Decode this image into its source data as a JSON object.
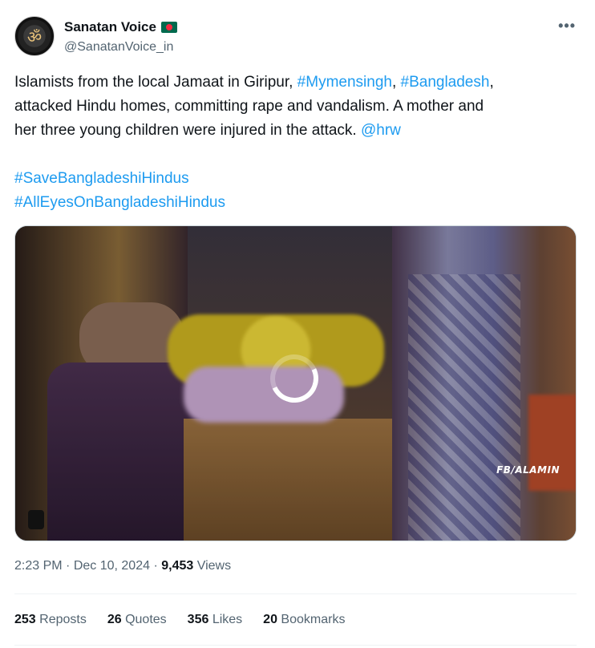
{
  "author": {
    "name": "Sanatan Voice",
    "handle": "@SanatanVoice_in",
    "avatar_glyph": "ॐ",
    "flag": "bangladesh-flag"
  },
  "more_label": "•••",
  "tweet": {
    "line1_a": "Islamists from the local Jamaat in Giripur, ",
    "tag1": "#Mymensingh",
    "sep1": ", ",
    "tag2": "#Bangladesh",
    "line1_b": ",",
    "line2": "attacked Hindu homes, committing rape and vandalism. A mother and",
    "line3": "her three young children were injured in the attack. ",
    "mention": "@hrw",
    "hashtag_a": "#SaveBangladeshiHindus",
    "hashtag_b": "#AllEyesOnBangladeshiHindus"
  },
  "media": {
    "watermark": "FB/ALAMIN",
    "state": "loading"
  },
  "meta": {
    "time": "2:23 PM",
    "dot": " · ",
    "date": "Dec 10, 2024",
    "views_count": "9,453",
    "views_label": " Views"
  },
  "stats": {
    "reposts_count": "253",
    "reposts_label": " Reposts",
    "quotes_count": "26",
    "quotes_label": " Quotes",
    "likes_count": "356",
    "likes_label": " Likes",
    "bookmarks_count": "20",
    "bookmarks_label": " Bookmarks"
  },
  "colors": {
    "link": "#1d9bf0",
    "text": "#0f1419",
    "secondary": "#536471"
  }
}
